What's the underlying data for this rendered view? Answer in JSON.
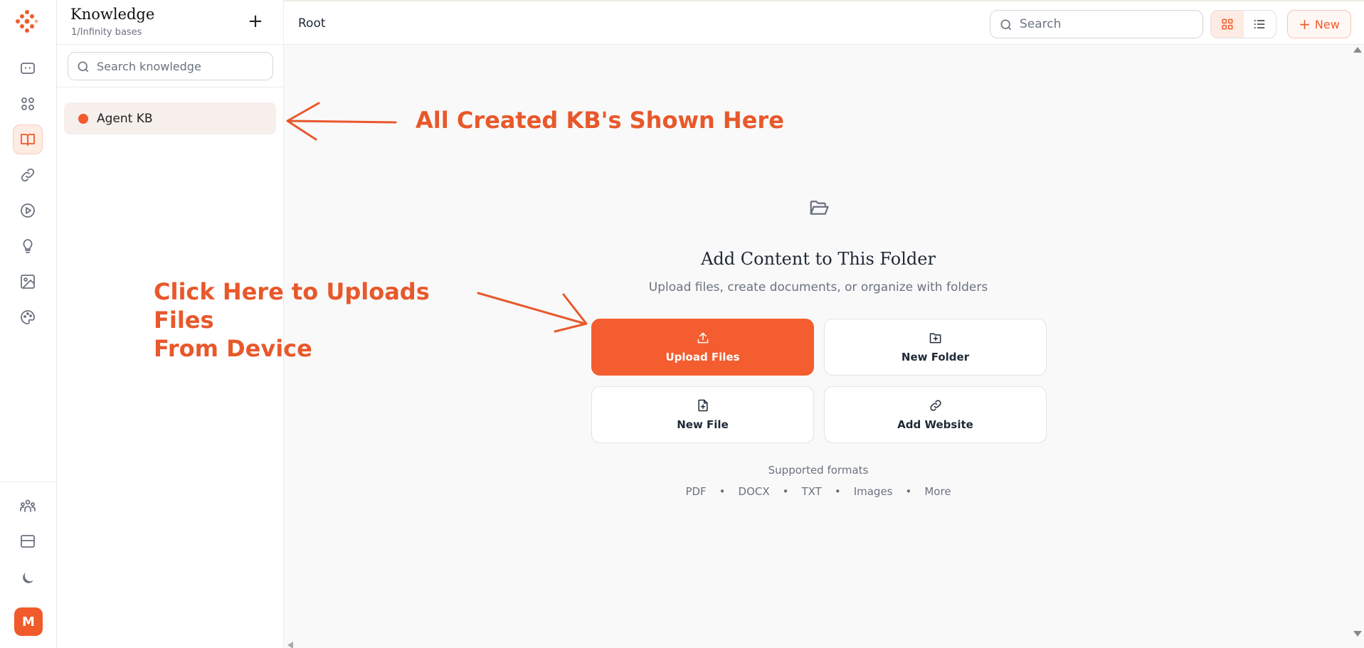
{
  "app": {
    "brand_color": "#f15a2b",
    "nav_icons": [
      "chat-icon",
      "apps-grid-icon",
      "book-icon",
      "link-icon",
      "play-icon",
      "lightbulb-icon",
      "image-icon",
      "palette-icon"
    ],
    "bottom_icons": [
      "team-icon",
      "layout-card-icon",
      "moon-icon"
    ],
    "avatar_initial": "M"
  },
  "knowledge_panel": {
    "title": "Knowledge",
    "subtitle": "1/Infinity bases",
    "add_label": "+",
    "search_placeholder": "Search knowledge",
    "items": [
      {
        "label": "Agent KB",
        "dot_color": "#f15a2b"
      }
    ]
  },
  "topbar": {
    "breadcrumb": "Root",
    "search_placeholder": "Search",
    "new_label": "New"
  },
  "empty_state": {
    "title": "Add Content to This Folder",
    "subtitle": "Upload files, create documents, or organize with folders",
    "actions": [
      {
        "label": "Upload Files",
        "icon": "upload-icon"
      },
      {
        "label": "New Folder",
        "icon": "folder-plus-icon"
      },
      {
        "label": "New File",
        "icon": "file-plus-icon"
      },
      {
        "label": "Add Website",
        "icon": "link-icon"
      }
    ],
    "formats_label": "Supported formats",
    "formats": [
      "PDF",
      "DOCX",
      "TXT",
      "Images",
      "More"
    ],
    "bullet": "•"
  },
  "annotations": {
    "kb_note": "All Created KB's Shown Here",
    "upload_note_line1": "Click Here to Uploads Files",
    "upload_note_line2": "From Device"
  }
}
